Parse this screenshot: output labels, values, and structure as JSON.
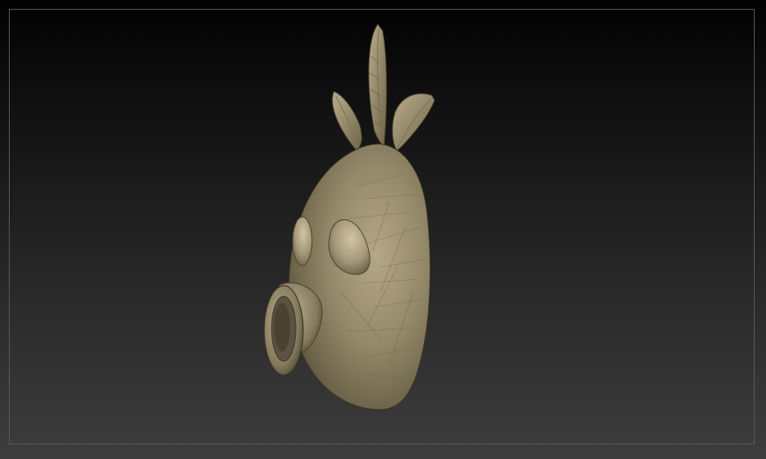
{
  "app": {
    "title": ""
  },
  "viewport": {
    "background_top": "#020202",
    "background_bottom": "#3d3d3d",
    "frame_color": "#5a5a5a"
  },
  "model": {
    "name": "",
    "material_color": "#9a8e70",
    "highlight_color": "#c8bd9c",
    "shadow_color": "#4a4232"
  }
}
